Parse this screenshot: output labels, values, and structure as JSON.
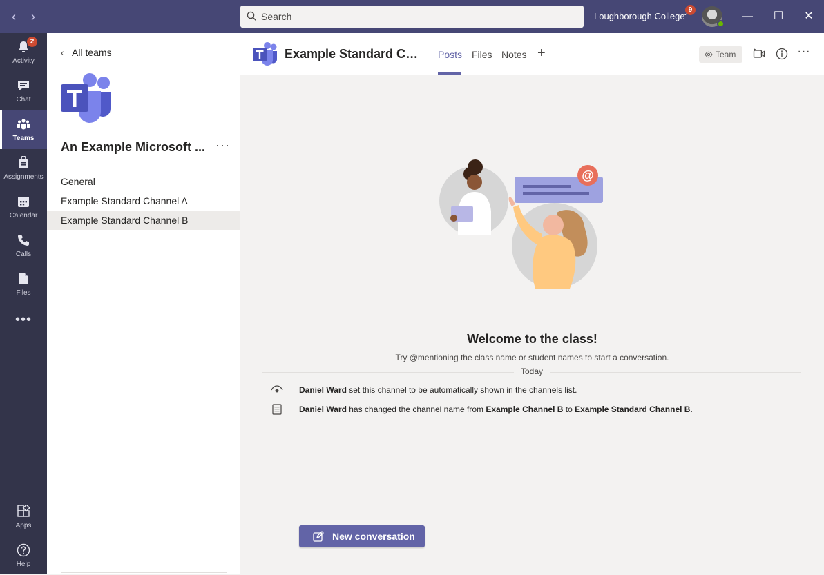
{
  "titlebar": {
    "search_placeholder": "Search",
    "org_name": "Loughborough College",
    "org_badge": "9"
  },
  "rail": {
    "items": [
      {
        "label": "Activity",
        "icon": "bell-icon",
        "badge": "2"
      },
      {
        "label": "Chat",
        "icon": "chat-icon"
      },
      {
        "label": "Teams",
        "icon": "teams-icon",
        "active": true
      },
      {
        "label": "Assignments",
        "icon": "assignments-icon"
      },
      {
        "label": "Calendar",
        "icon": "calendar-icon"
      },
      {
        "label": "Calls",
        "icon": "phone-icon"
      },
      {
        "label": "Files",
        "icon": "file-icon"
      }
    ],
    "more": "•••",
    "bottom": [
      {
        "label": "Apps",
        "icon": "apps-icon"
      },
      {
        "label": "Help",
        "icon": "help-icon"
      }
    ]
  },
  "team_panel": {
    "back_label": "All teams",
    "team_name": "An Example Microsoft ...",
    "more": "···",
    "channels": [
      {
        "label": "General"
      },
      {
        "label": "Example Standard Channel A"
      },
      {
        "label": "Example Standard Channel B",
        "selected": true
      }
    ]
  },
  "header": {
    "channel_title": "Example Standard Ch...",
    "tabs": [
      {
        "label": "Posts",
        "active": true
      },
      {
        "label": "Files"
      },
      {
        "label": "Notes"
      }
    ],
    "add_tab": "+",
    "team_pill": "Team",
    "more": "···"
  },
  "main": {
    "welcome_title": "Welcome to the class!",
    "welcome_sub": "Try @mentioning the class name or student names to start a conversation.",
    "date_divider": "Today",
    "events": [
      {
        "actor": "Daniel Ward",
        "text": " set this channel to be automatically shown in the channels list.",
        "icon": "eye-icon"
      },
      {
        "actor": "Daniel Ward",
        "text1": " has changed the channel name from ",
        "old": "Example Channel B",
        "text2": " to ",
        "new": "Example Standard Channel B",
        "end": ".",
        "icon": "channel-rename-icon"
      }
    ],
    "new_conversation": "New conversation"
  },
  "colors": {
    "titlebar": "#464775",
    "rail": "#33344a",
    "accent": "#6264a7",
    "badge": "#cc4a31"
  }
}
